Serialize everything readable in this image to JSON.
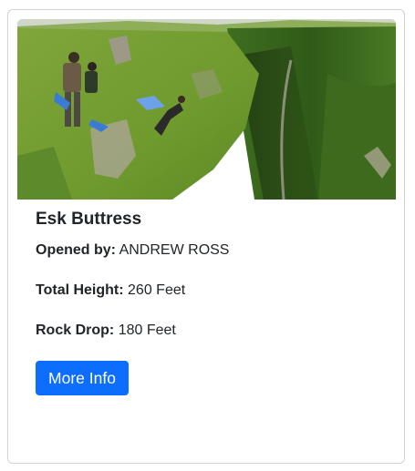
{
  "card": {
    "title": "Esk Buttress",
    "opened_by": {
      "label": "Opened by:",
      "value": "ANDREW ROSS"
    },
    "total_height": {
      "label": "Total Height:",
      "value": "260 Feet"
    },
    "rock_drop": {
      "label": "Rock Drop:",
      "value": "180 Feet"
    },
    "button_label": "More Info"
  },
  "colors": {
    "button_bg": "#0d6efd",
    "button_text": "#ffffff",
    "text": "#212529",
    "card_border": "#dee2e6"
  },
  "image": {
    "subject": "base-jumper-leaping-off-grassy-cliff-photo"
  }
}
